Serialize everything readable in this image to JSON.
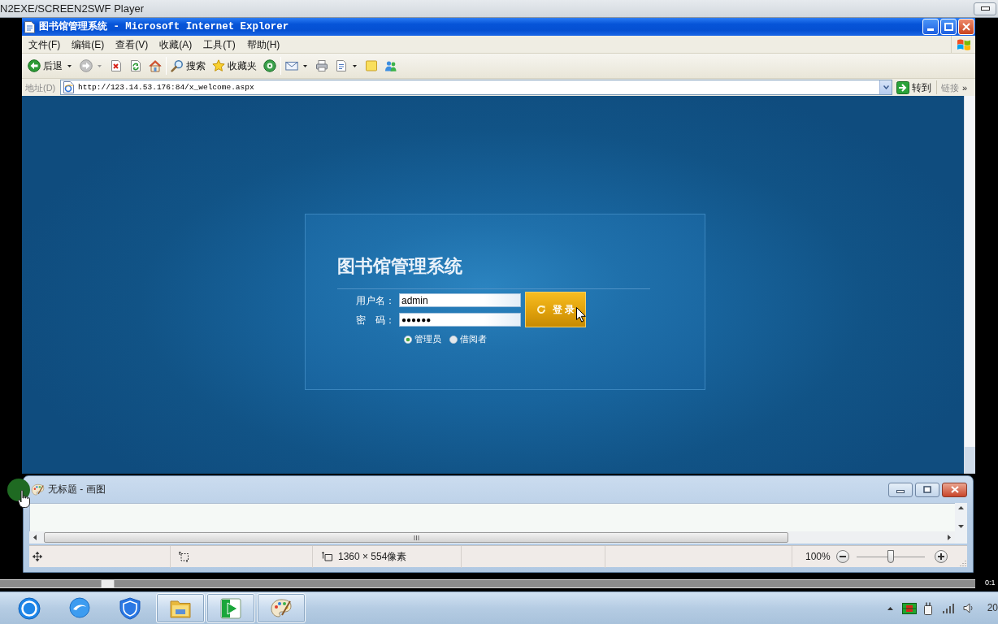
{
  "player": {
    "title": "N2EXE/SCREEN2SWF Player",
    "seek": {
      "level": 0.11
    },
    "time": "0:1"
  },
  "browser": {
    "title": "图书馆管理系统 - Microsoft Internet Explorer",
    "menu": [
      "文件(F)",
      "编辑(E)",
      "查看(V)",
      "收藏(A)",
      "工具(T)",
      "帮助(H)"
    ],
    "toolbar": [
      {
        "items": [
          {
            "kind": "back",
            "label": "后退",
            "dropdown": true
          },
          {
            "kind": "forward",
            "dropdown": true
          },
          {
            "kind": "stop",
            "dropdown": false
          },
          {
            "kind": "refresh",
            "dropdown": false
          },
          {
            "kind": "home",
            "dropdown": false
          }
        ]
      },
      {
        "items": [
          {
            "kind": "search",
            "label": "搜索",
            "dropdown": false
          },
          {
            "kind": "favorites",
            "label": "收藏夹",
            "dropdown": false
          },
          {
            "kind": "media",
            "dropdown": false
          }
        ]
      },
      {
        "items": [
          {
            "kind": "mail",
            "dropdown": true
          },
          {
            "kind": "print",
            "dropdown": false
          },
          {
            "kind": "edit",
            "dropdown": true
          },
          {
            "kind": "note",
            "dropdown": false
          },
          {
            "kind": "messenger",
            "dropdown": false
          }
        ]
      }
    ],
    "address": {
      "label": "地址(D)",
      "value": "http://123.14.53.176:84/x_welcome.aspx",
      "go": "转到",
      "links": "链接",
      "more": "»"
    }
  },
  "login": {
    "title": "图书馆管理系统",
    "fields": [
      {
        "kind": "text",
        "label": "用户名：",
        "value": "admin"
      },
      {
        "kind": "password",
        "label": "密　码：",
        "value": "●●●●●●"
      }
    ],
    "roles": [
      {
        "label": "管理员",
        "selected": true
      },
      {
        "label": "借阅者",
        "selected": false
      }
    ],
    "button": "登 录"
  },
  "paint": {
    "title": "无标题 - 画图",
    "size": "1360 × 554像素",
    "zoom": "100%",
    "zoom_slider": {
      "level": 0.5
    }
  },
  "taskbar": {
    "apps": [
      {
        "kind": "ring",
        "running": false
      },
      {
        "kind": "bubble",
        "running": false
      },
      {
        "kind": "shield",
        "running": false
      },
      {
        "kind": "folder",
        "running": true
      },
      {
        "kind": "play-tile",
        "running": true
      },
      {
        "kind": "palette",
        "running": true
      }
    ],
    "clock": "20"
  }
}
